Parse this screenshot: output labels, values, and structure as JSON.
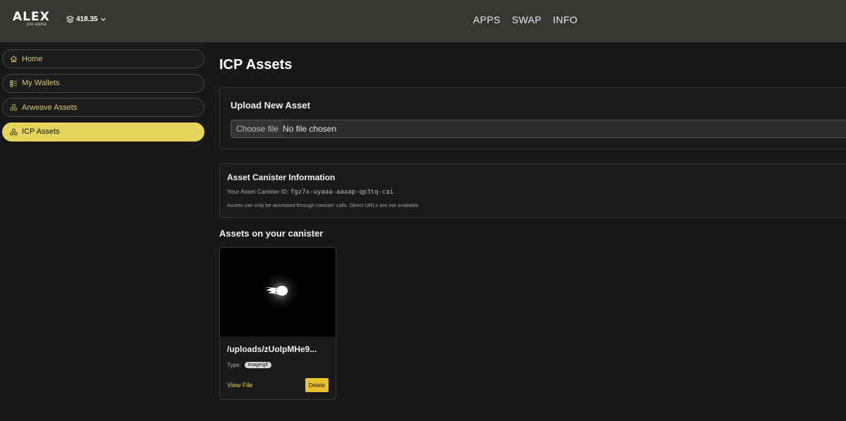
{
  "header": {
    "logo_text": "ALEX",
    "logo_sub": "pre-alpha",
    "balance": "418.35",
    "nav": [
      "APPS",
      "SWAP",
      "INFO"
    ]
  },
  "sidebar": {
    "items": [
      {
        "label": "Home",
        "icon": "home-icon",
        "active": false
      },
      {
        "label": "My Wallets",
        "icon": "wallet-list-icon",
        "active": false
      },
      {
        "label": "Arweave Assets",
        "icon": "assets-icon",
        "active": false
      },
      {
        "label": "ICP Assets",
        "icon": "assets-icon",
        "active": true
      }
    ]
  },
  "main": {
    "title": "ICP Assets",
    "upload": {
      "title": "Upload New Asset",
      "choose_label": "Choose file",
      "no_file_label": "No file chosen"
    },
    "canister_info": {
      "title": "Asset Canister Information",
      "id_label": "Your Asset Canister ID:",
      "id_value": "fgz7x-uyaaa-aaaap-qp3tq-cai",
      "note": "Assets can only be accessed through canister calls. Direct URLs are not available."
    },
    "assets_section_title": "Assets on your canister",
    "assets": [
      {
        "name": "/uploads/zUoIpMHe9...",
        "type_label": "Type:",
        "type": "image/gif",
        "view_label": "View File",
        "delete_label": "Delete"
      }
    ]
  },
  "colors": {
    "accent": "#e5d55a",
    "delete": "#e8c02e",
    "header_bg": "#393734",
    "page_bg": "#181818"
  }
}
